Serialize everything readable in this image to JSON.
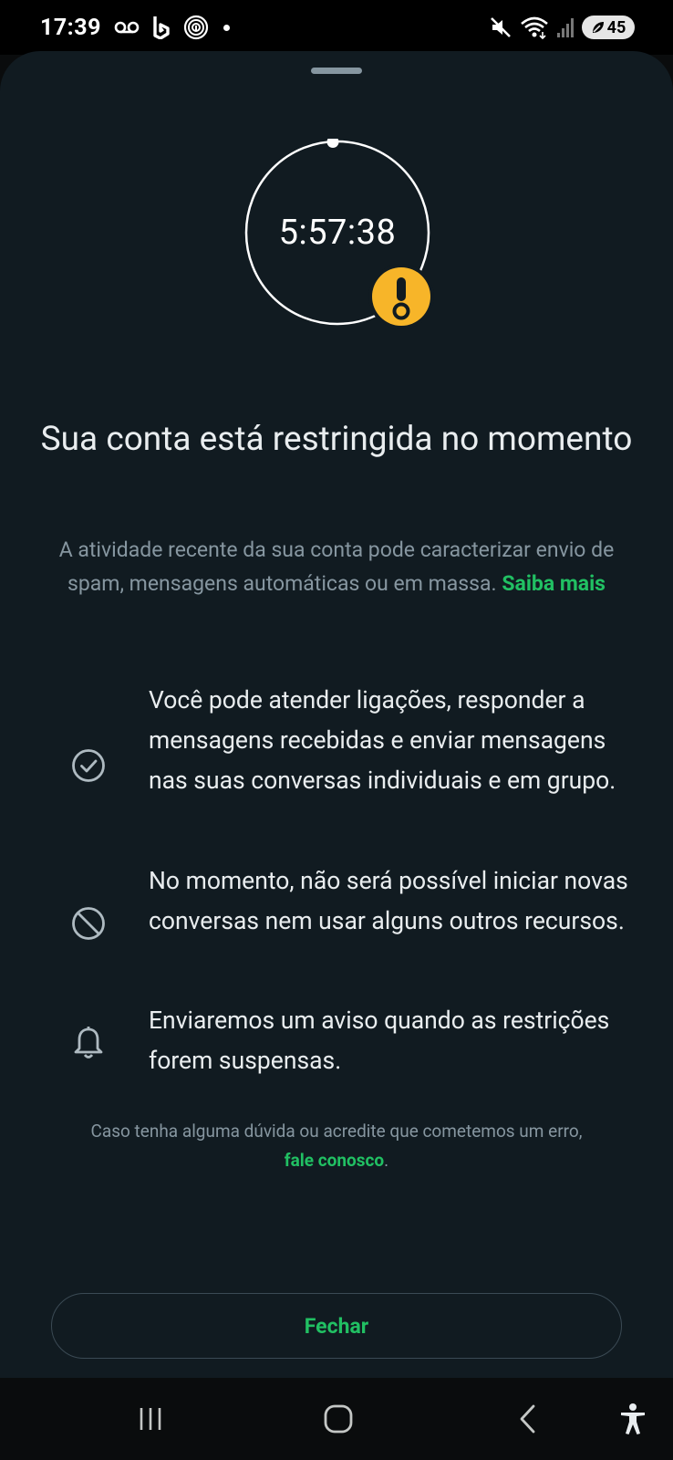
{
  "status_bar": {
    "time": "17:39",
    "left_icons": [
      "voicemail-icon",
      "b-app-icon",
      "fingerprint-app-icon",
      "notification-dot"
    ],
    "right_icons": [
      "mute-icon",
      "wifi-icon",
      "signal-icon",
      "battery-icon"
    ],
    "battery_level": "45"
  },
  "timer": {
    "value": "5:57:38",
    "badge_icon": "warning-icon",
    "badge_color": "#f7b529"
  },
  "title": "Sua conta está restringida no momento",
  "description": {
    "text": "A atividade recente da sua conta pode caracterizar envio de spam, mensagens automáticas ou em massa.",
    "link": "Saiba mais"
  },
  "features": [
    {
      "icon": "check-circle-icon",
      "text": "Você pode atender ligações, responder a mensagens recebidas e enviar mensagens nas suas conversas individuais e em grupo."
    },
    {
      "icon": "block-icon",
      "text": "No momento, não será possível iniciar novas conversas nem usar alguns outros recursos."
    },
    {
      "icon": "bell-icon",
      "text": "Enviaremos um aviso quando as restrições forem suspensas."
    }
  ],
  "contact": {
    "text": "Caso tenha alguma dúvida ou acredite que cometemos um erro,",
    "link": "fale conosco",
    "suffix": "."
  },
  "close_button": "Fechar",
  "colors": {
    "accent": "#21c063",
    "background": "#111b21",
    "muted_text": "#8696a0",
    "warning": "#f7b529"
  },
  "nav_bar": {
    "buttons": [
      "recents-icon",
      "home-icon",
      "back-icon",
      "accessibility-icon"
    ]
  }
}
